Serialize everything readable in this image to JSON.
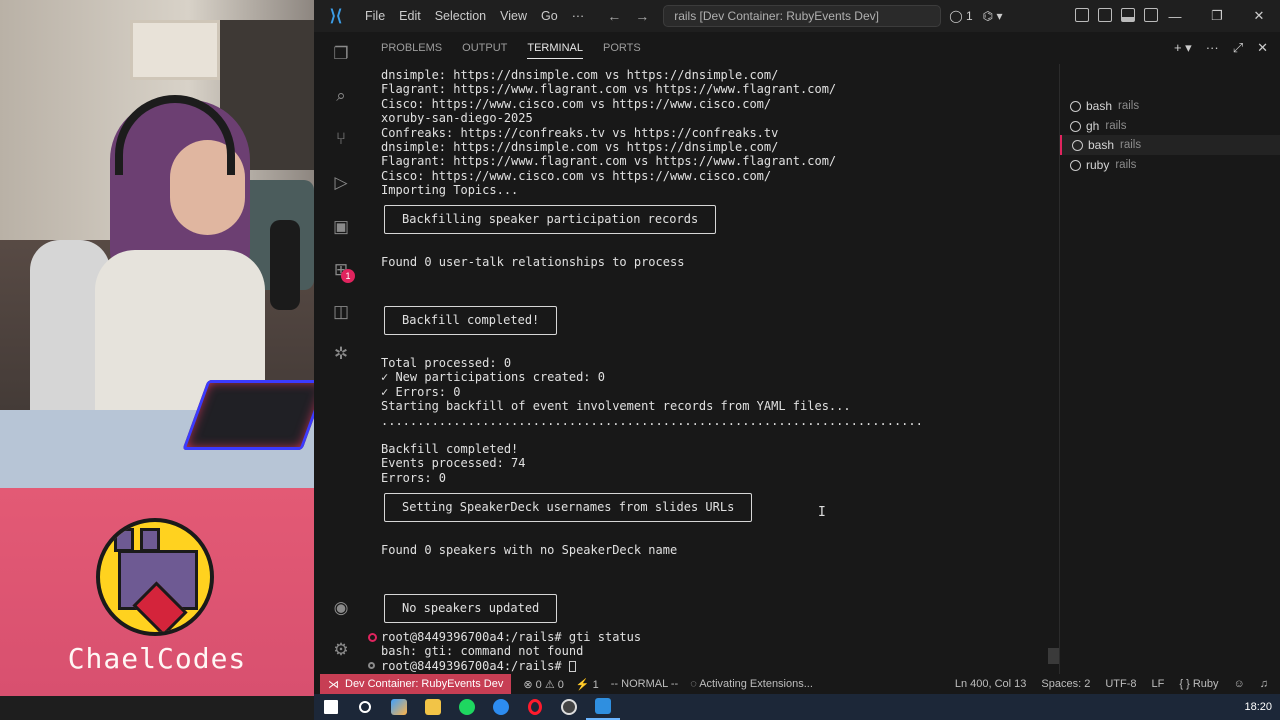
{
  "stream": {
    "brand": "ChaelCodes"
  },
  "titlebar": {
    "menu": [
      "File",
      "Edit",
      "Selection",
      "View",
      "Go",
      "···"
    ],
    "search": "rails [Dev Container: RubyEvents Dev]",
    "copilot_count": "1"
  },
  "panel": {
    "tabs": [
      "PROBLEMS",
      "OUTPUT",
      "TERMINAL",
      "PORTS"
    ],
    "active_tab": "TERMINAL"
  },
  "terminal": {
    "lines_top": [
      "dnsimple: https://dnsimple.com vs https://dnsimple.com/",
      "Flagrant: https://www.flagrant.com vs https://www.flagrant.com/",
      "Cisco: https://www.cisco.com vs https://www.cisco.com/",
      "xoruby-san-diego-2025",
      "Confreaks: https://confreaks.tv vs https://confreaks.tv",
      "dnsimple: https://dnsimple.com vs https://dnsimple.com/",
      "Flagrant: https://www.flagrant.com vs https://www.flagrant.com/",
      "Cisco: https://www.cisco.com vs https://www.cisco.com/",
      "Importing Topics..."
    ],
    "box1": "Backfilling speaker participation records",
    "found_user_talk": "Found 0 user-talk relationships to process",
    "box2": "Backfill completed!",
    "stats": [
      "Total processed: 0",
      "✓ New participations created: 0",
      "✓ Errors: 0",
      "Starting backfill of event involvement records from YAML files...",
      "..........................................................................."
    ],
    "backfill2": [
      "Backfill completed!",
      "Events processed: 74",
      "Errors: 0"
    ],
    "box3": "Setting SpeakerDeck usernames from slides URLs",
    "found_speakers": "Found 0 speakers with no SpeakerDeck name",
    "box4": "No speakers updated",
    "prompt1": "root@8449396700a4:/rails# gti status",
    "error_line": "bash: gti: command not found",
    "prompt2": "root@8449396700a4:/rails# "
  },
  "terminal_list": [
    {
      "name": "bash",
      "sub": "rails"
    },
    {
      "name": "gh",
      "sub": "rails"
    },
    {
      "name": "bash",
      "sub": "rails"
    },
    {
      "name": "ruby",
      "sub": "rails"
    }
  ],
  "statusbar": {
    "remote": "Dev Container: RubyEvents Dev",
    "errors": "0",
    "warnings": "0",
    "ports": "1",
    "mode": "-- NORMAL --",
    "activity": "Activating Extensions...",
    "position": "Ln 400, Col 13",
    "spaces": "Spaces: 2",
    "encoding": "UTF-8",
    "eol": "LF",
    "language": "Ruby"
  },
  "taskbar": {
    "time": "18:20"
  },
  "colors": {
    "accent_red": "#c73e54",
    "badge": "#e0245e",
    "vscode_blue": "#3c9ee8",
    "overlay_pink": "#e35a75"
  }
}
